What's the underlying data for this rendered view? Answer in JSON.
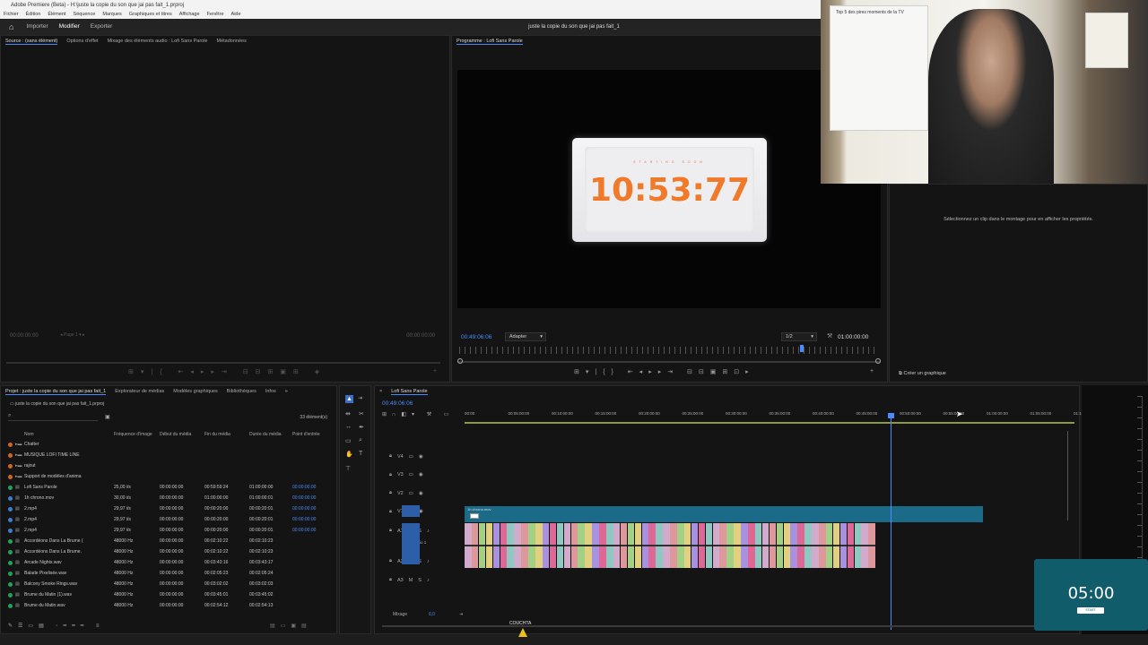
{
  "window": {
    "title": "Adobe Premiere (Beta) - H:\\juste la copie du son que jai pas fait_1.prproj"
  },
  "menu": [
    "Fichier",
    "Édition",
    "Élément",
    "Séquence",
    "Marques",
    "Graphiques et titres",
    "Affichage",
    "Fenêtre",
    "Aide"
  ],
  "workspace": {
    "tabs": [
      "Importer",
      "Modifier",
      "Exporter"
    ],
    "active": "Modifier",
    "document_title": "juste la copie du son que jai pas fait_1"
  },
  "source_panel": {
    "tabs": [
      "Source : (sans élément)",
      "Options d'effet",
      "Mixage des éléments audio : Lofi Sans Parole",
      "Métadonnées"
    ],
    "timecode_left": "00:00:00:00",
    "timecode_right": "00:00:00:00",
    "page_label": "Page 1"
  },
  "program_panel": {
    "tab": "Programme : Lofi Sans Parole",
    "timecode": "00:49:06:06",
    "fit": "Adapter",
    "resolution": "1/2",
    "duration": "01:00:00:00",
    "overlay": {
      "caption": "STARTING SOON",
      "clock": "10:53:77"
    }
  },
  "properties_panel": {
    "message": "Sélectionnez un clip dans le montage pour en afficher les propriétés.",
    "create_graphic": "Créer un graphique"
  },
  "project_panel": {
    "tabs": [
      "Projet : juste la copie du son que jai pas fait_1",
      "Explorateur de médias",
      "Modèles graphiques",
      "Bibliothèques",
      "Infos"
    ],
    "path": "juste la copie du son que jai pas fait_1.prproj",
    "count": "33 élément(s)",
    "columns": [
      "Nom",
      "Fréquence d'image",
      "Début du média",
      "Fin du média",
      "Durée du média",
      "Point d'entrée"
    ],
    "rows": [
      {
        "color": "#d2651f",
        "name": "Chatter",
        "fps": "",
        "start": "",
        "end": "",
        "dur": "",
        "in": "",
        "folder": true
      },
      {
        "color": "#d2651f",
        "name": "MUSIQUE LOFI TIME LINE",
        "fps": "",
        "start": "",
        "end": "",
        "dur": "",
        "in": "",
        "folder": true
      },
      {
        "color": "#d2651f",
        "name": "rajout",
        "fps": "",
        "start": "",
        "end": "",
        "dur": "",
        "in": "",
        "folder": true
      },
      {
        "color": "#d2651f",
        "name": "Support de modèles d'anima",
        "fps": "",
        "start": "",
        "end": "",
        "dur": "",
        "in": "",
        "folder": true
      },
      {
        "color": "#1ea35a",
        "name": "Lofi Sans Parole",
        "fps": "25,00 i/s",
        "start": "00:00:00:00",
        "end": "00:59:59:24",
        "dur": "01:00:00:00",
        "in": "00:00:00:00"
      },
      {
        "color": "#3a7fd0",
        "name": "1h chrono.mov",
        "fps": "30,00 i/s",
        "start": "00:00:00:00",
        "end": "01:00:00:00",
        "dur": "01:00:00:01",
        "in": "00:00:00:00"
      },
      {
        "color": "#3a7fd0",
        "name": "2.mp4",
        "fps": "29,97 i/s",
        "start": "00:00:00:00",
        "end": "00:00:20:00",
        "dur": "00:00:20:01",
        "in": "00:00:00:00"
      },
      {
        "color": "#3a7fd0",
        "name": "2.mp4",
        "fps": "29,97 i/s",
        "start": "00:00:00:00",
        "end": "00:00:20:00",
        "dur": "00:00:20:01",
        "in": "00:00:00:00"
      },
      {
        "color": "#3a7fd0",
        "name": "2.mp4",
        "fps": "29,97 i/s",
        "start": "00:00:00:00",
        "end": "00:00:20:00",
        "dur": "00:00:20:01",
        "in": "00:00:00:00"
      },
      {
        "color": "#1ea35a",
        "name": "Accordéons Dans La Brume (",
        "fps": "48000 Hz",
        "start": "00:00:00:00",
        "end": "00:02:10:22",
        "dur": "00:02:10:23",
        "in": ""
      },
      {
        "color": "#1ea35a",
        "name": "Accordéons Dans La Brume.",
        "fps": "48000 Hz",
        "start": "00:00:00:00",
        "end": "00:02:10:22",
        "dur": "00:02:10:23",
        "in": ""
      },
      {
        "color": "#1ea35a",
        "name": "Arcade Nights.wav",
        "fps": "48000 Hz",
        "start": "00:00:00:00",
        "end": "00:03:43:16",
        "dur": "00:03:43:17",
        "in": ""
      },
      {
        "color": "#1ea35a",
        "name": "Balade Pixelisée.wav",
        "fps": "48000 Hz",
        "start": "00:00:00:00",
        "end": "00:02:05:23",
        "dur": "00:02:05:24",
        "in": ""
      },
      {
        "color": "#1ea35a",
        "name": "Balcony Smoke Rings.wav",
        "fps": "48000 Hz",
        "start": "00:00:00:00",
        "end": "00:03:02:02",
        "dur": "00:03:02:03",
        "in": ""
      },
      {
        "color": "#1ea35a",
        "name": "Brume du Matin (1).wav",
        "fps": "48000 Hz",
        "start": "00:00:00:00",
        "end": "00:03:45:01",
        "dur": "00:03:45:02",
        "in": ""
      },
      {
        "color": "#1ea35a",
        "name": "Brume du Matin.wav",
        "fps": "48000 Hz",
        "start": "00:00:00:00",
        "end": "00:02:54:12",
        "dur": "00:02:54:13",
        "in": ""
      }
    ]
  },
  "timeline": {
    "tab": "Lofi Sans Parole",
    "timecode": "00:49:06:06",
    "ruler": [
      "00:00",
      "00:05:00:00",
      "00:10:00:00",
      "00:15:00:00",
      "00:20:00:00",
      "00:25:00:00",
      "00:30:00:00",
      "00:35:00:00",
      "00:40:00:00",
      "00:45:00:00",
      "00:50:00:00",
      "00:55:00:00",
      "01:00:00:00",
      "01:05:00:00",
      "01:10:"
    ],
    "video_tracks": [
      "V4",
      "V3",
      "V2",
      "V1"
    ],
    "audio_tracks": [
      "A1",
      "A2",
      "A3"
    ],
    "a1_name": "Audio 1",
    "video_clip": "1h chrono.mov",
    "mix_label": "Mixage",
    "mix_value": "0,0",
    "audio_clip_colors": [
      "#e2b8dc",
      "#f0a3a8",
      "#aee08f",
      "#f4e08a",
      "#b59cf0",
      "#ef6fa0",
      "#9ad8d0"
    ]
  },
  "webcam": {
    "whiteboard_title": "Top 5 des pires moments de la TV"
  },
  "mini_widget": {
    "time": "05:00",
    "button": "START"
  },
  "cursor_label": "COUCHTA"
}
